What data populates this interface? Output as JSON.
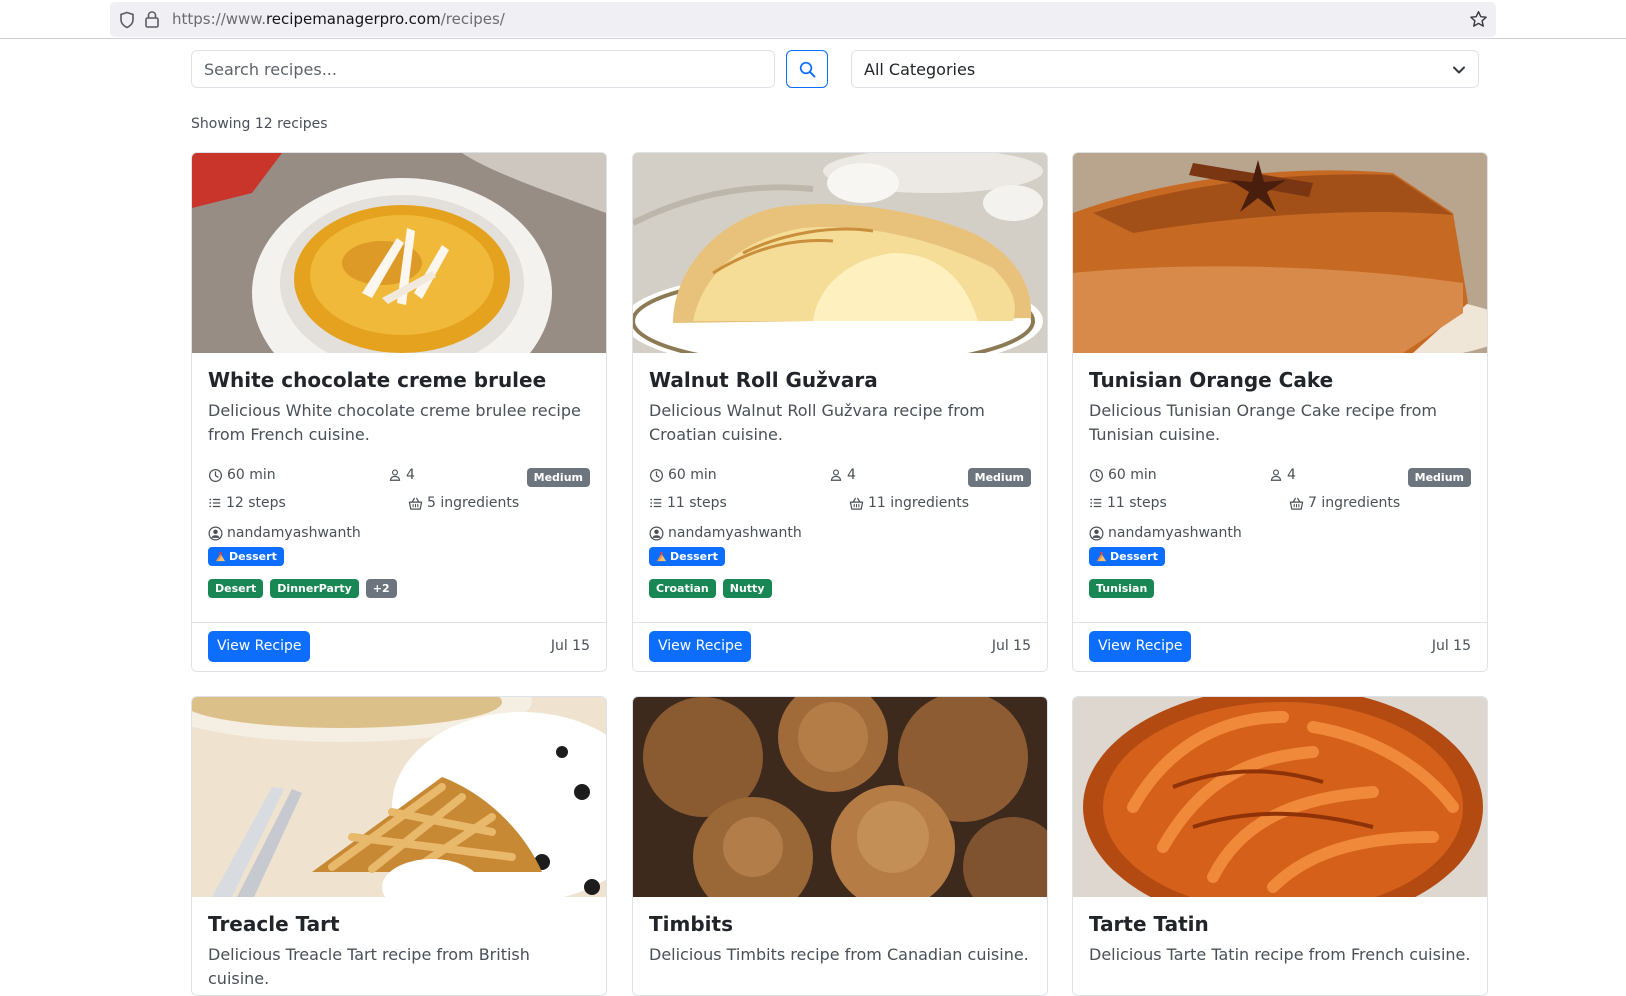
{
  "browser": {
    "url_prefix": "https://www.",
    "url_domain": "recipemanagerpro.com",
    "url_path": "/recipes/"
  },
  "search": {
    "placeholder": "Search recipes..."
  },
  "filter": {
    "selected": "All Categories"
  },
  "results": {
    "count_text": "Showing 12 recipes"
  },
  "colors": {
    "primary": "#0d6efd",
    "success": "#198754",
    "secondary": "#6c757d"
  },
  "recipes": [
    {
      "title": "White chocolate creme brulee",
      "description": "Delicious White chocolate creme brulee recipe from French cuisine.",
      "time": "60 min",
      "servings": "4",
      "difficulty": "Medium",
      "steps": "12 steps",
      "ingredients": "5 ingredients",
      "author": "nandamyashwanth",
      "category": "Dessert",
      "tags": [
        "Desert",
        "DinnerParty"
      ],
      "more_tags": "+2",
      "button": "View Recipe",
      "date": "Jul 15"
    },
    {
      "title": "Walnut Roll Gužvara",
      "description": "Delicious Walnut Roll Gužvara recipe from Croatian cuisine.",
      "time": "60 min",
      "servings": "4",
      "difficulty": "Medium",
      "steps": "11 steps",
      "ingredients": "11 ingredients",
      "author": "nandamyashwanth",
      "category": "Dessert",
      "tags": [
        "Croatian",
        "Nutty"
      ],
      "button": "View Recipe",
      "date": "Jul 15"
    },
    {
      "title": "Tunisian Orange Cake",
      "description": "Delicious Tunisian Orange Cake recipe from Tunisian cuisine.",
      "time": "60 min",
      "servings": "4",
      "difficulty": "Medium",
      "steps": "11 steps",
      "ingredients": "7 ingredients",
      "author": "nandamyashwanth",
      "category": "Dessert",
      "tags": [
        "Tunisian"
      ],
      "button": "View Recipe",
      "date": "Jul 15"
    },
    {
      "title": "Treacle Tart",
      "description": "Delicious Treacle Tart recipe from British cuisine."
    },
    {
      "title": "Timbits",
      "description": "Delicious Timbits recipe from Canadian cuisine."
    },
    {
      "title": "Tarte Tatin",
      "description": "Delicious Tarte Tatin recipe from French cuisine."
    }
  ]
}
